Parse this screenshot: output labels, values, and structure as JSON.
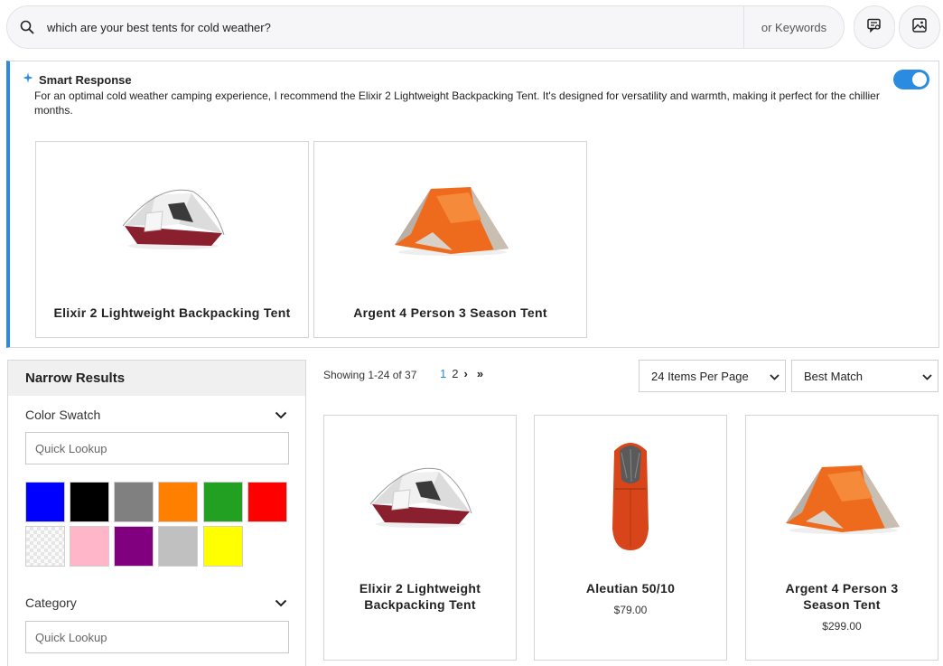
{
  "search": {
    "query": "which are your best tents for cold weather?",
    "keywords_label": "or Keywords",
    "icons": [
      "search-icon",
      "chat-search-icon",
      "image-search-icon"
    ]
  },
  "smart_response": {
    "title": "Smart Response",
    "text": "For an optimal cold weather camping experience, I recommend the Elixir 2 Lightweight Backpacking Tent. It's designed for versatility and warmth, making it perfect for the chillier months.",
    "toggle_on": true,
    "accent_color": "#2b8be0",
    "products": [
      {
        "name": "Elixir 2 Lightweight Backpacking Tent"
      },
      {
        "name": "Argent 4 Person 3 Season Tent"
      }
    ]
  },
  "sidebar": {
    "title": "Narrow Results",
    "facets": [
      {
        "label": "Color Swatch",
        "placeholder": "Quick Lookup"
      },
      {
        "label": "Category",
        "placeholder": "Quick Lookup"
      }
    ],
    "swatches": [
      "#0000ff",
      "#000000",
      "#808080",
      "#ff8000",
      "#22a022",
      "#ff0000",
      "pattern",
      "#ffb6c8",
      "#800080",
      "#c0c0c0",
      "#ffff00"
    ]
  },
  "results": {
    "showing": "Showing 1-24 of 37",
    "pages": [
      "1",
      "2"
    ],
    "current_page": "1",
    "next": "›",
    "last": "»",
    "per_page": "24 Items Per Page",
    "sort": "Best Match",
    "products": [
      {
        "name": "Elixir 2 Lightweight Backpacking Tent",
        "price": ""
      },
      {
        "name": "Aleutian 50/10",
        "price": "$79.00"
      },
      {
        "name": "Argent 4 Person 3 Season Tent",
        "price": "$299.00"
      }
    ]
  }
}
